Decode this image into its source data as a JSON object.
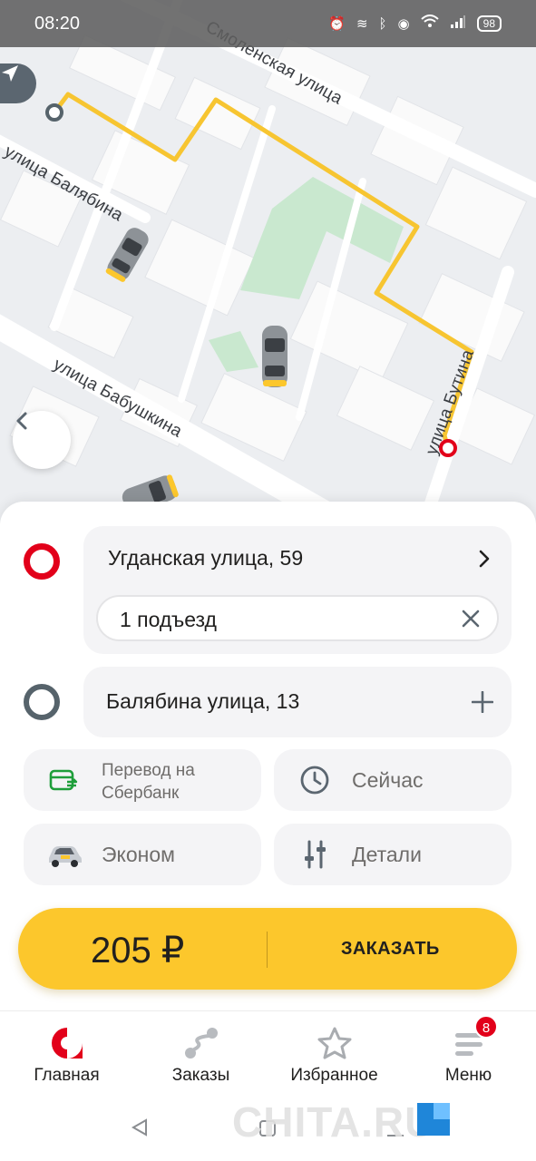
{
  "status_bar": {
    "time": "08:20",
    "battery": "98"
  },
  "map": {
    "streets": {
      "smolenskaya": "Смоленская улица",
      "balyabina": "улица Балябина",
      "babushkina": "улица Бабушкина",
      "butina": "улица Бутина"
    }
  },
  "route": {
    "from": {
      "address": "Угданская улица, 59",
      "entrance": "1 подъезд"
    },
    "to": {
      "address": "Балябина улица, 13"
    }
  },
  "options": {
    "payment": "Перевод на Сбербанк",
    "time": "Сейчас",
    "tariff": "Эконом",
    "details": "Детали"
  },
  "order": {
    "price": "205 ₽",
    "button": "ЗАКАЗАТЬ"
  },
  "tabs": [
    {
      "label": "Главная"
    },
    {
      "label": "Заказы"
    },
    {
      "label": "Избранное"
    },
    {
      "label": "Меню",
      "badge": "8"
    }
  ],
  "watermark": "CHITA.RU",
  "colors": {
    "accent": "#fcc72c",
    "route": "#f7c531",
    "from_marker": "#e2001a",
    "to_marker": "#56636b"
  }
}
